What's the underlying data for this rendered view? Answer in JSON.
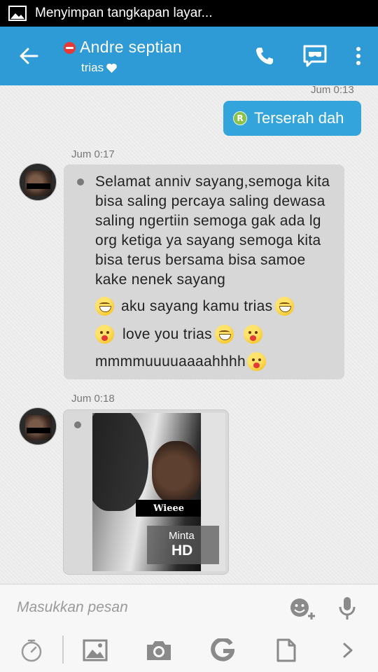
{
  "status_bar": {
    "notification_text": "Menyimpan tangkapan layar..."
  },
  "header": {
    "contact_name": "Andre septian",
    "contact_subtitle": "trias",
    "subtitle_icon": "heart-icon",
    "accent_color": "#2e9ad6"
  },
  "messages": [
    {
      "direction": "outgoing",
      "timestamp": "Jum 0:13",
      "badge": "R",
      "text": "Terserah dah"
    },
    {
      "direction": "incoming",
      "timestamp": "Jum 0:17",
      "text": "Selamat anniv sayang,semoga kita bisa saling percaya saling dewasa saling ngertiin semoga gak ada lg org ketiga ya sayang semoga kita bisa terus bersama bisa samoe kake nenek sayang",
      "emoji_lines": [
        {
          "text": "aku sayang kamu trias"
        },
        {
          "text": "love you trias"
        },
        {
          "text": "mmmmuuuuaaaahhhh"
        }
      ]
    },
    {
      "direction": "incoming",
      "timestamp": "Jum 0:18",
      "type": "image",
      "watermark": "Wieee",
      "hd_button": {
        "small": "Minta",
        "big": "HD"
      }
    }
  ],
  "composer": {
    "placeholder": "Masukkan pesan"
  },
  "toolbar": {
    "items": [
      "timer-icon",
      "gallery-icon",
      "camera-icon",
      "google-icon",
      "document-icon",
      "chevron-right-icon"
    ]
  }
}
